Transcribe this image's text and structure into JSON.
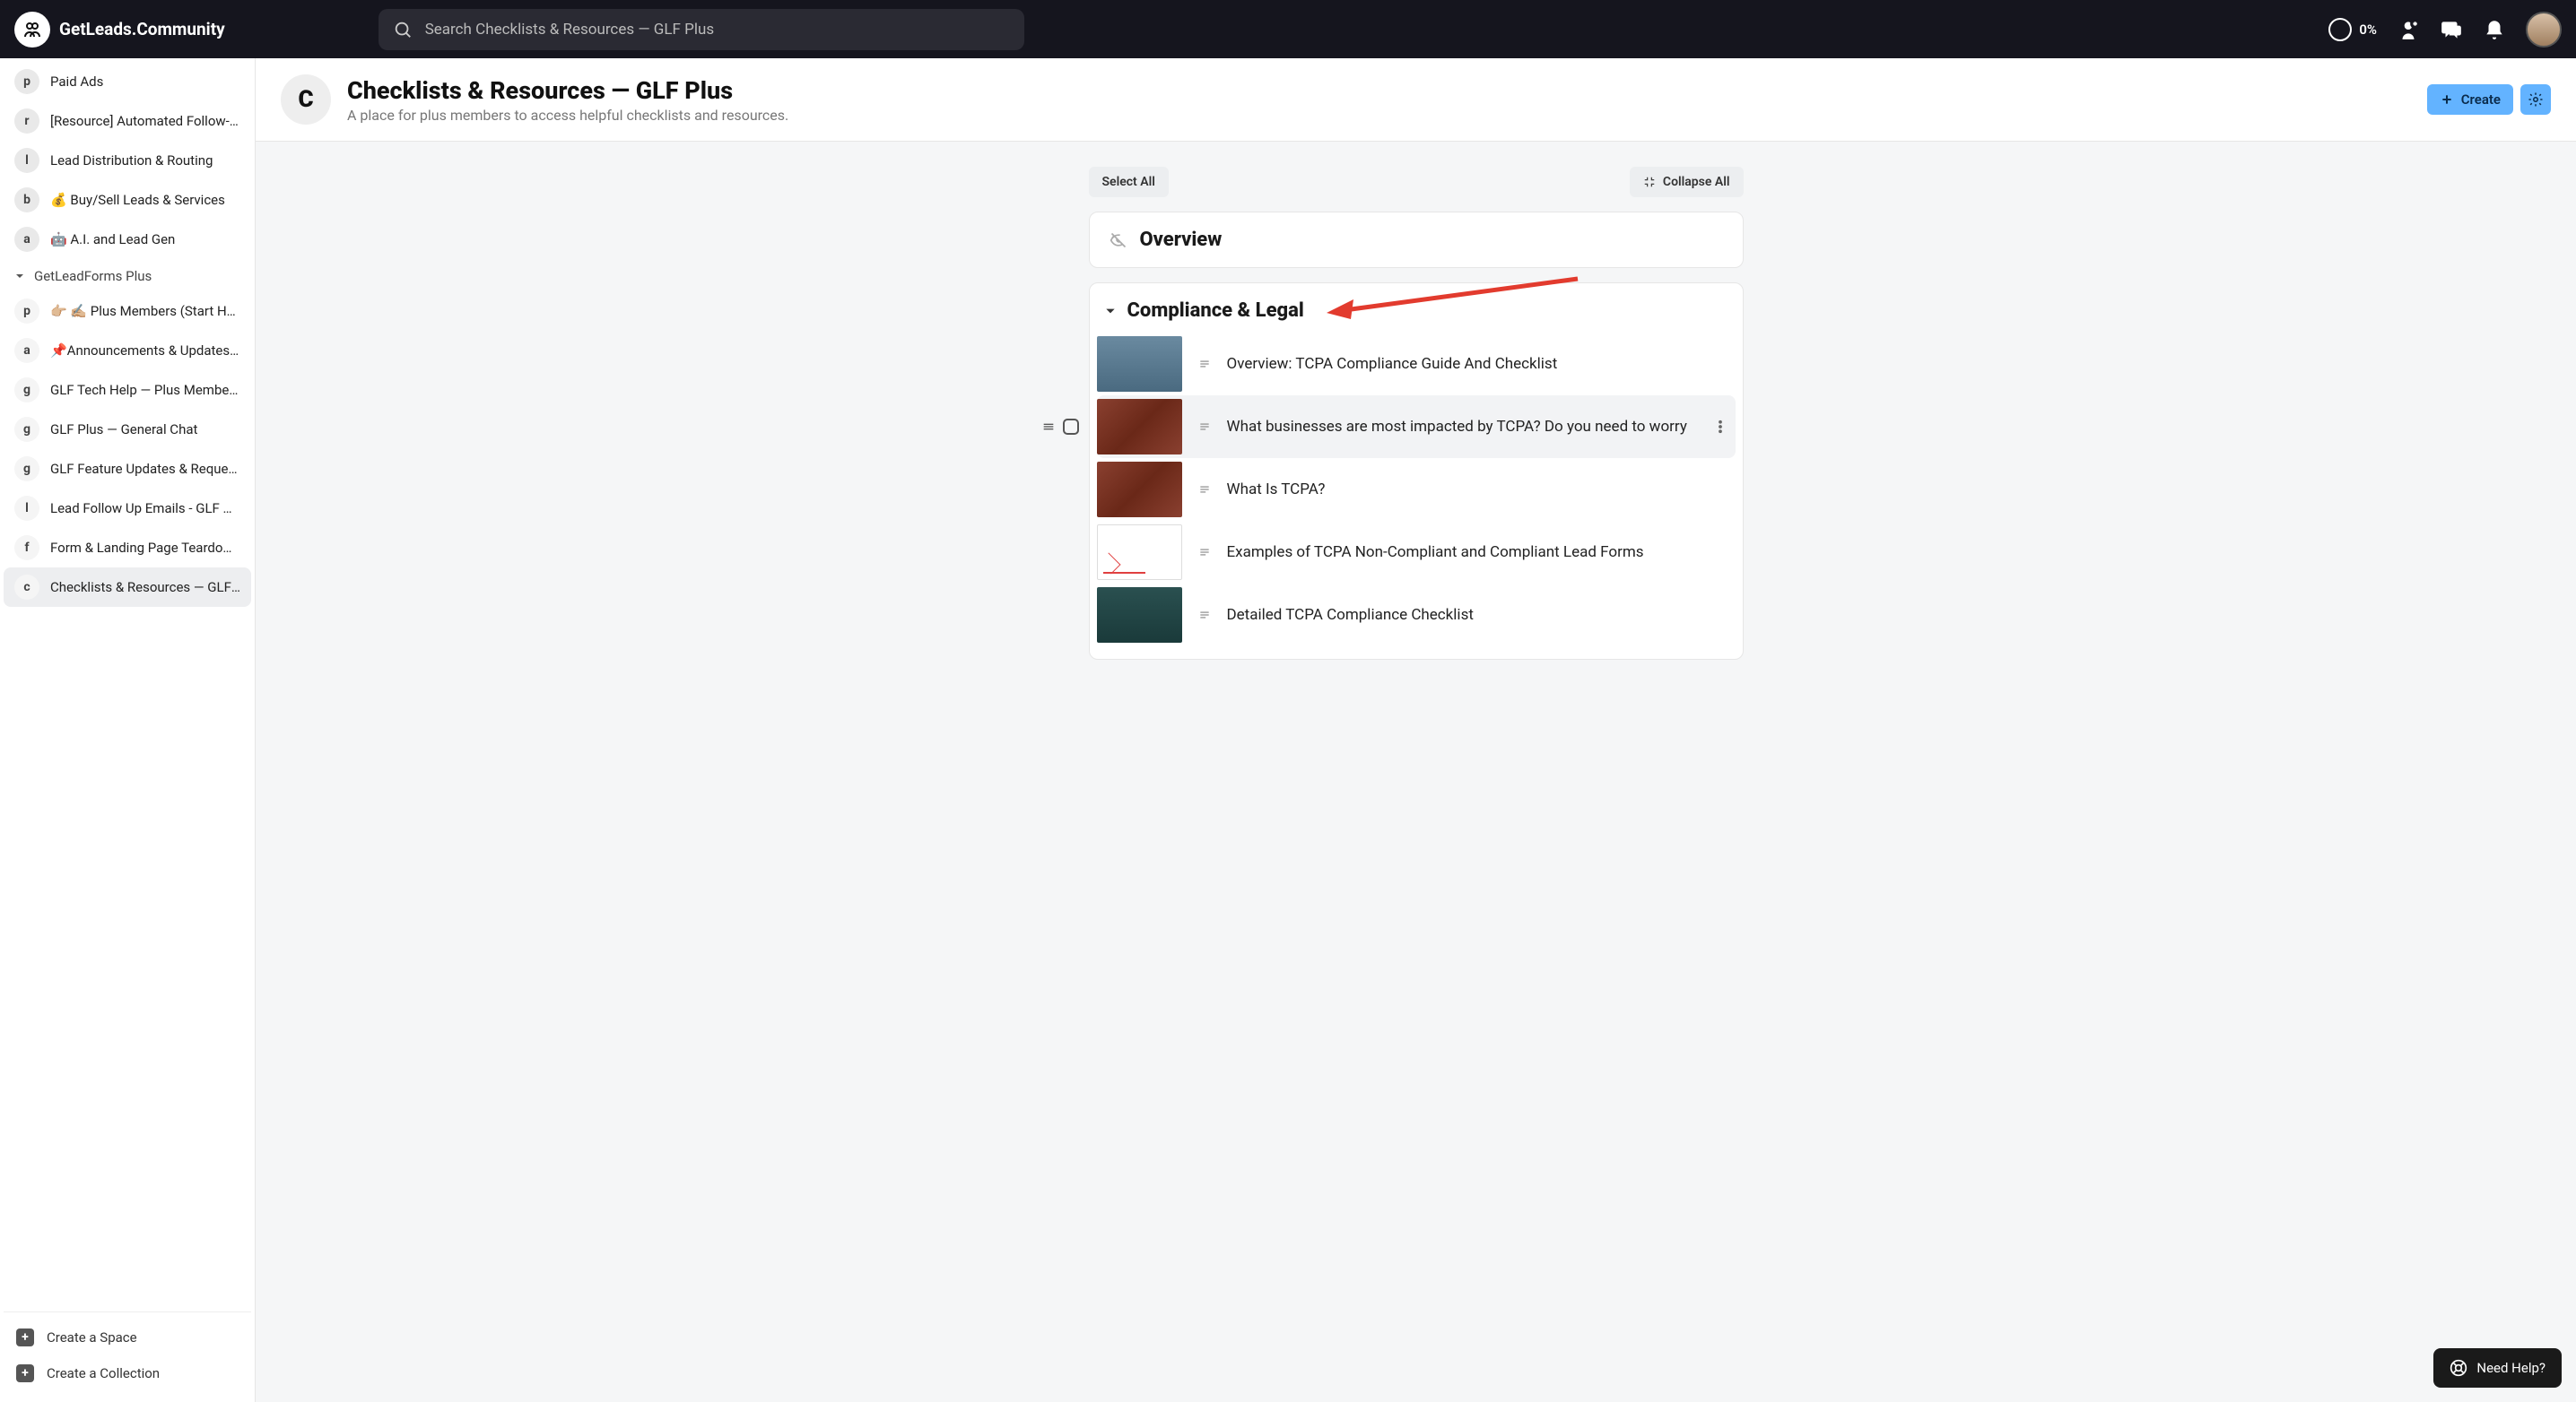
{
  "brand": "GetLeads.Community",
  "search": {
    "placeholder": "Search Checklists & Resources — GLF Plus"
  },
  "progress": "0%",
  "sidebar": {
    "topItems": [
      {
        "badge": "p",
        "label": "Paid Ads"
      },
      {
        "badge": "r",
        "label": "[Resource] Automated Follow-up"
      },
      {
        "badge": "l",
        "label": "Lead Distribution & Routing"
      },
      {
        "badge": "b",
        "label": "💰 Buy/Sell Leads & Services"
      },
      {
        "badge": "a",
        "label": "🤖 A.I. and Lead Gen"
      }
    ],
    "section": "GetLeadForms Plus",
    "plusItems": [
      {
        "badge": "p",
        "label": "👉🏼 ✍🏼 Plus Members (Start Here)"
      },
      {
        "badge": "a",
        "label": "📌Announcements & Updates - Plus"
      },
      {
        "badge": "g",
        "label": "GLF Tech Help — Plus Members"
      },
      {
        "badge": "g",
        "label": "GLF Plus — General Chat"
      },
      {
        "badge": "g",
        "label": "GLF Feature Updates & Requests"
      },
      {
        "badge": "l",
        "label": "Lead Follow Up Emails - GLF Plus"
      },
      {
        "badge": "f",
        "label": "Form & Landing Page Teardowns"
      },
      {
        "badge": "c",
        "label": "Checklists & Resources — GLF Plus"
      }
    ],
    "footer": {
      "createSpace": "Create a Space",
      "createCollection": "Create a Collection"
    }
  },
  "page": {
    "avatar": "C",
    "title": "Checklists & Resources — GLF Plus",
    "subtitle": "A place for plus members to access helpful checklists and resources.",
    "createBtn": "Create"
  },
  "toolbar": {
    "selectAll": "Select All",
    "collapseAll": "Collapse All"
  },
  "sections": {
    "overview": "Overview",
    "compliance": "Compliance & Legal"
  },
  "complianceItems": [
    {
      "thumb": "blue1",
      "title": "Overview: TCPA Compliance Guide And Checklist"
    },
    {
      "thumb": "red",
      "title": "What businesses are most impacted by TCPA? Do you need to worry"
    },
    {
      "thumb": "red",
      "title": "What Is TCPA?"
    },
    {
      "thumb": "form",
      "title": "Examples of TCPA Non-Compliant and Compliant Lead Forms"
    },
    {
      "thumb": "teal",
      "title": "Detailed TCPA Compliance Checklist"
    }
  ],
  "help": "Need Help?"
}
